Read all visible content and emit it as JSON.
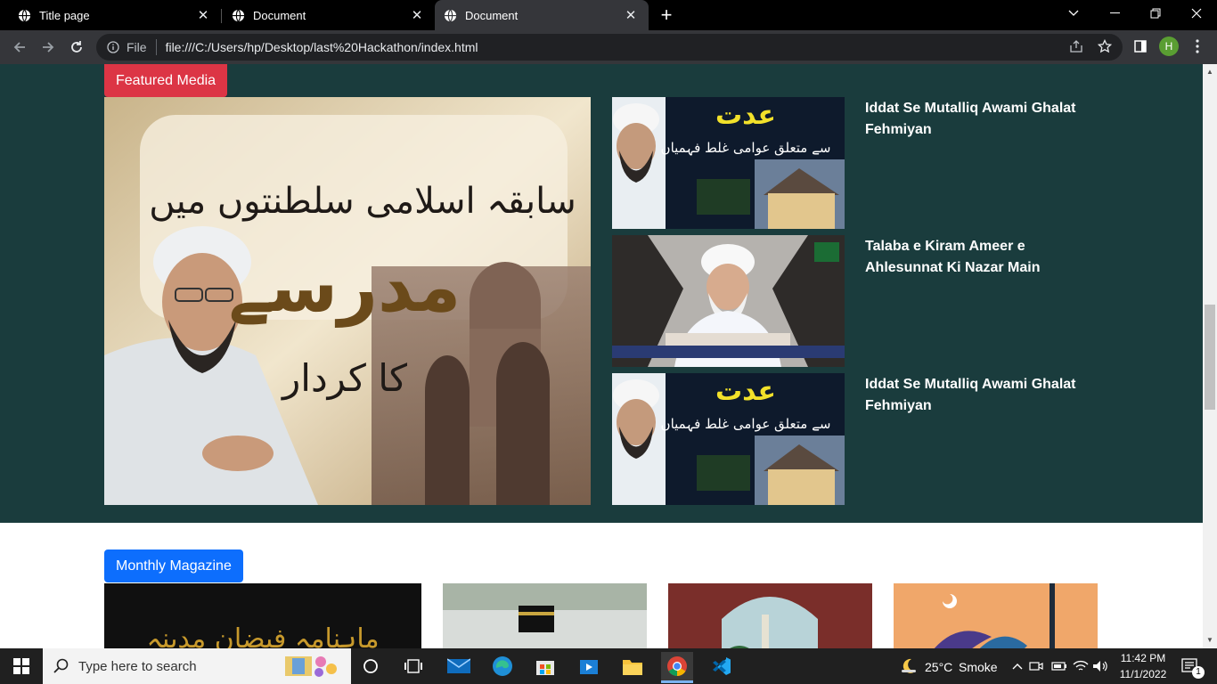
{
  "browser": {
    "tabs": [
      {
        "title": "Title page",
        "active": false
      },
      {
        "title": "Document",
        "active": false
      },
      {
        "title": "Document",
        "active": true
      }
    ],
    "new_tab_symbol": "+",
    "omnibox": {
      "scheme_label": "File",
      "url": "file:///C:/Users/hp/Desktop/last%20Hackathon/index.html"
    },
    "profile_initial": "H"
  },
  "page": {
    "featured": {
      "badge": "Featured Media",
      "hero_text": {
        "line1": "سابقہ اسلامی سلطنتوں میں",
        "line2": "مدرسے",
        "line3": "کا کردار"
      },
      "items": [
        {
          "title": "Iddat Se Mutalliq Awami Ghalat Fehmiyan",
          "thumb_text": {
            "big": "عدت",
            "small": "سے متعلق عوامی غلط فہمیاں"
          }
        },
        {
          "title": "Talaba e Kiram Ameer e Ahlesunnat Ki Nazar Main",
          "thumb_text": {
            "big": "",
            "small": ""
          }
        },
        {
          "title": "Iddat Se Mutalliq Awami Ghalat Fehmiyan",
          "thumb_text": {
            "big": "عدت",
            "small": "سے متعلق عوامی غلط فہمیاں"
          }
        }
      ]
    },
    "magazine": {
      "badge": "Monthly Magazine",
      "card1_text": "ماہنامہ فیضانِ مدینہ"
    }
  },
  "taskbar": {
    "search_placeholder": "Type here to search",
    "weather": {
      "temp": "25°C",
      "condition": "Smoke"
    },
    "time": "11:42 PM",
    "date": "11/1/2022",
    "notification_count": "1"
  },
  "colors": {
    "featured_bg": "#1a3c3d",
    "badge_red": "#dc3545",
    "badge_blue": "#0d6efd"
  }
}
